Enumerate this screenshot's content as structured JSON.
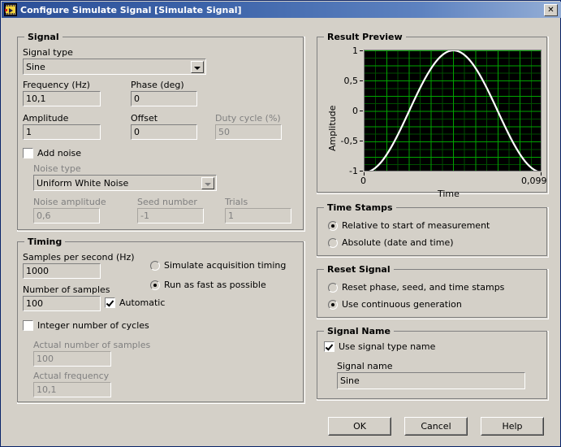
{
  "window": {
    "title": "Configure Simulate Signal [Simulate Signal]",
    "icon": "labview-vi-icon",
    "close_label": "✕"
  },
  "signal": {
    "group_title": "Signal",
    "signal_type_label": "Signal type",
    "signal_type_value": "Sine",
    "frequency_label": "Frequency (Hz)",
    "frequency_value": "10,1",
    "phase_label": "Phase (deg)",
    "phase_value": "0",
    "amplitude_label": "Amplitude",
    "amplitude_value": "1",
    "offset_label": "Offset",
    "offset_value": "0",
    "duty_cycle_label": "Duty cycle (%)",
    "duty_cycle_value": "50",
    "add_noise_label": "Add noise",
    "add_noise_checked": false,
    "noise_type_label": "Noise type",
    "noise_type_value": "Uniform White Noise",
    "noise_amplitude_label": "Noise amplitude",
    "noise_amplitude_value": "0,6",
    "seed_number_label": "Seed number",
    "seed_number_value": "-1",
    "trials_label": "Trials",
    "trials_value": "1"
  },
  "timing": {
    "group_title": "Timing",
    "samples_per_second_label": "Samples per second (Hz)",
    "samples_per_second_value": "1000",
    "number_of_samples_label": "Number of samples",
    "number_of_samples_value": "100",
    "automatic_label": "Automatic",
    "automatic_checked": true,
    "simulate_acquisition_label": "Simulate acquisition timing",
    "run_as_fast_label": "Run as fast as possible",
    "timing_mode_selected": "run_as_fast",
    "integer_cycles_label": "Integer number of cycles",
    "integer_cycles_checked": false,
    "actual_samples_label": "Actual number of samples",
    "actual_samples_value": "100",
    "actual_frequency_label": "Actual frequency",
    "actual_frequency_value": "10,1"
  },
  "result_preview": {
    "group_title": "Result Preview"
  },
  "time_stamps": {
    "group_title": "Time Stamps",
    "relative_label": "Relative to start of measurement",
    "absolute_label": "Absolute (date and time)",
    "selected": "relative"
  },
  "reset_signal": {
    "group_title": "Reset Signal",
    "reset_phase_label": "Reset phase, seed, and time stamps",
    "continuous_label": "Use continuous generation",
    "selected": "continuous"
  },
  "signal_name": {
    "group_title": "Signal Name",
    "use_type_name_label": "Use signal type name",
    "use_type_name_checked": true,
    "signal_name_label": "Signal name",
    "signal_name_value": "Sine"
  },
  "buttons": {
    "ok": "OK",
    "cancel": "Cancel",
    "help": "Help"
  },
  "chart_data": {
    "type": "line",
    "title": "Result Preview",
    "xlabel": "Time",
    "ylabel": "Amplitude",
    "xlim": [
      0,
      0.099
    ],
    "ylim": [
      -1,
      1
    ],
    "xticks": [
      "0",
      "0,099"
    ],
    "yticks": [
      "1",
      "0,5",
      "0",
      "-0,5",
      "-1"
    ],
    "ytick_values": [
      1,
      0.5,
      0,
      -0.5,
      -1
    ],
    "grid": true,
    "grid_color": "#00a000",
    "minor_grid_color": "#004d00",
    "plot_bg": "#000000",
    "trace_color": "#ffffff",
    "legend": "none",
    "series": [
      {
        "name": "Sine",
        "waveform": "sine",
        "amplitude": 1,
        "frequency_hz": 10.1,
        "phase_deg": 0,
        "offset": 0,
        "samples": 100,
        "sample_rate_hz": 1000,
        "description": "One cycle of a 10,1 Hz sine starting at -1, peaking at +1 near the center, returning to -1"
      }
    ]
  }
}
